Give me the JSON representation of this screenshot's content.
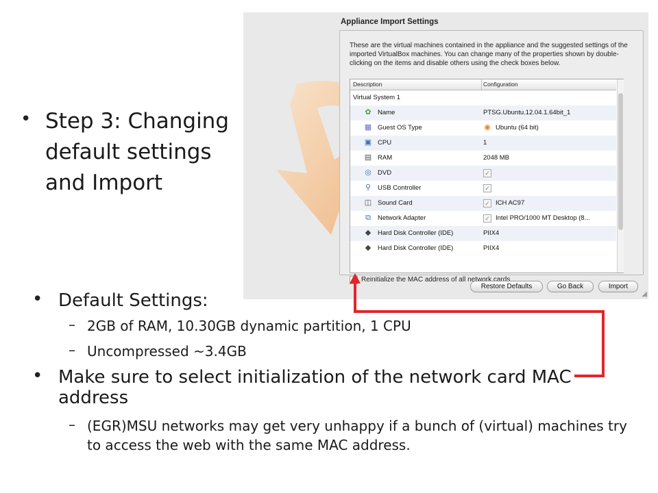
{
  "slide": {
    "step_bullet": "Step 3: Changing default settings and Import",
    "default_settings_bullet": "Default Settings:",
    "default_sub1": "2GB of RAM, 10.30GB dynamic partition, 1 CPU",
    "default_sub2": "Uncompressed ~3.4GB",
    "mac_bullet": "Make sure to select initialization of the network card MAC address",
    "mac_sub": "(EGR)MSU networks may get very unhappy if a bunch of (virtual) machines try to access the web with the same MAC address."
  },
  "dialog": {
    "title": "Appliance Import Settings",
    "description": "These are the virtual machines contained in the appliance and the suggested settings of the imported VirtualBox machines. You can change many of the properties shown by double-clicking on the items and disable others using the check boxes below.",
    "columns": [
      "Description",
      "Configuration"
    ],
    "group": "Virtual System 1",
    "rows": [
      {
        "icon": "name-icon",
        "label": "Name",
        "value": "PTSG.Ubuntu.12.04.1.64bit_1",
        "checkbox": false
      },
      {
        "icon": "os-icon",
        "label": "Guest OS Type",
        "value": "Ubuntu (64 bit)",
        "checkbox": false
      },
      {
        "icon": "cpu-icon",
        "label": "CPU",
        "value": "1",
        "checkbox": false
      },
      {
        "icon": "ram-icon",
        "label": "RAM",
        "value": "2048 MB",
        "checkbox": false
      },
      {
        "icon": "dvd-icon",
        "label": "DVD",
        "value": "",
        "checkbox": true
      },
      {
        "icon": "usb-icon",
        "label": "USB Controller",
        "value": "",
        "checkbox": true
      },
      {
        "icon": "sound-icon",
        "label": "Sound Card",
        "value": "ICH AC97",
        "checkbox": true
      },
      {
        "icon": "network-icon",
        "label": "Network Adapter",
        "value": "Intel PRO/1000 MT Desktop (8...",
        "checkbox": true
      },
      {
        "icon": "disk-controller-icon",
        "label": "Hard Disk Controller (IDE)",
        "value": "PIIX4",
        "checkbox": false
      },
      {
        "icon": "disk-controller-icon",
        "label": "Hard Disk Controller (IDE)",
        "value": "PIIX4",
        "checkbox": false
      }
    ],
    "reinit_label": "Reinitialize the MAC address of all network cards",
    "reinit_checked": false,
    "buttons": {
      "restore": "Restore Defaults",
      "back": "Go Back",
      "import": "Import"
    }
  },
  "colors": {
    "arrow": "#e0262b",
    "deco_orange": "#f3a65a"
  }
}
